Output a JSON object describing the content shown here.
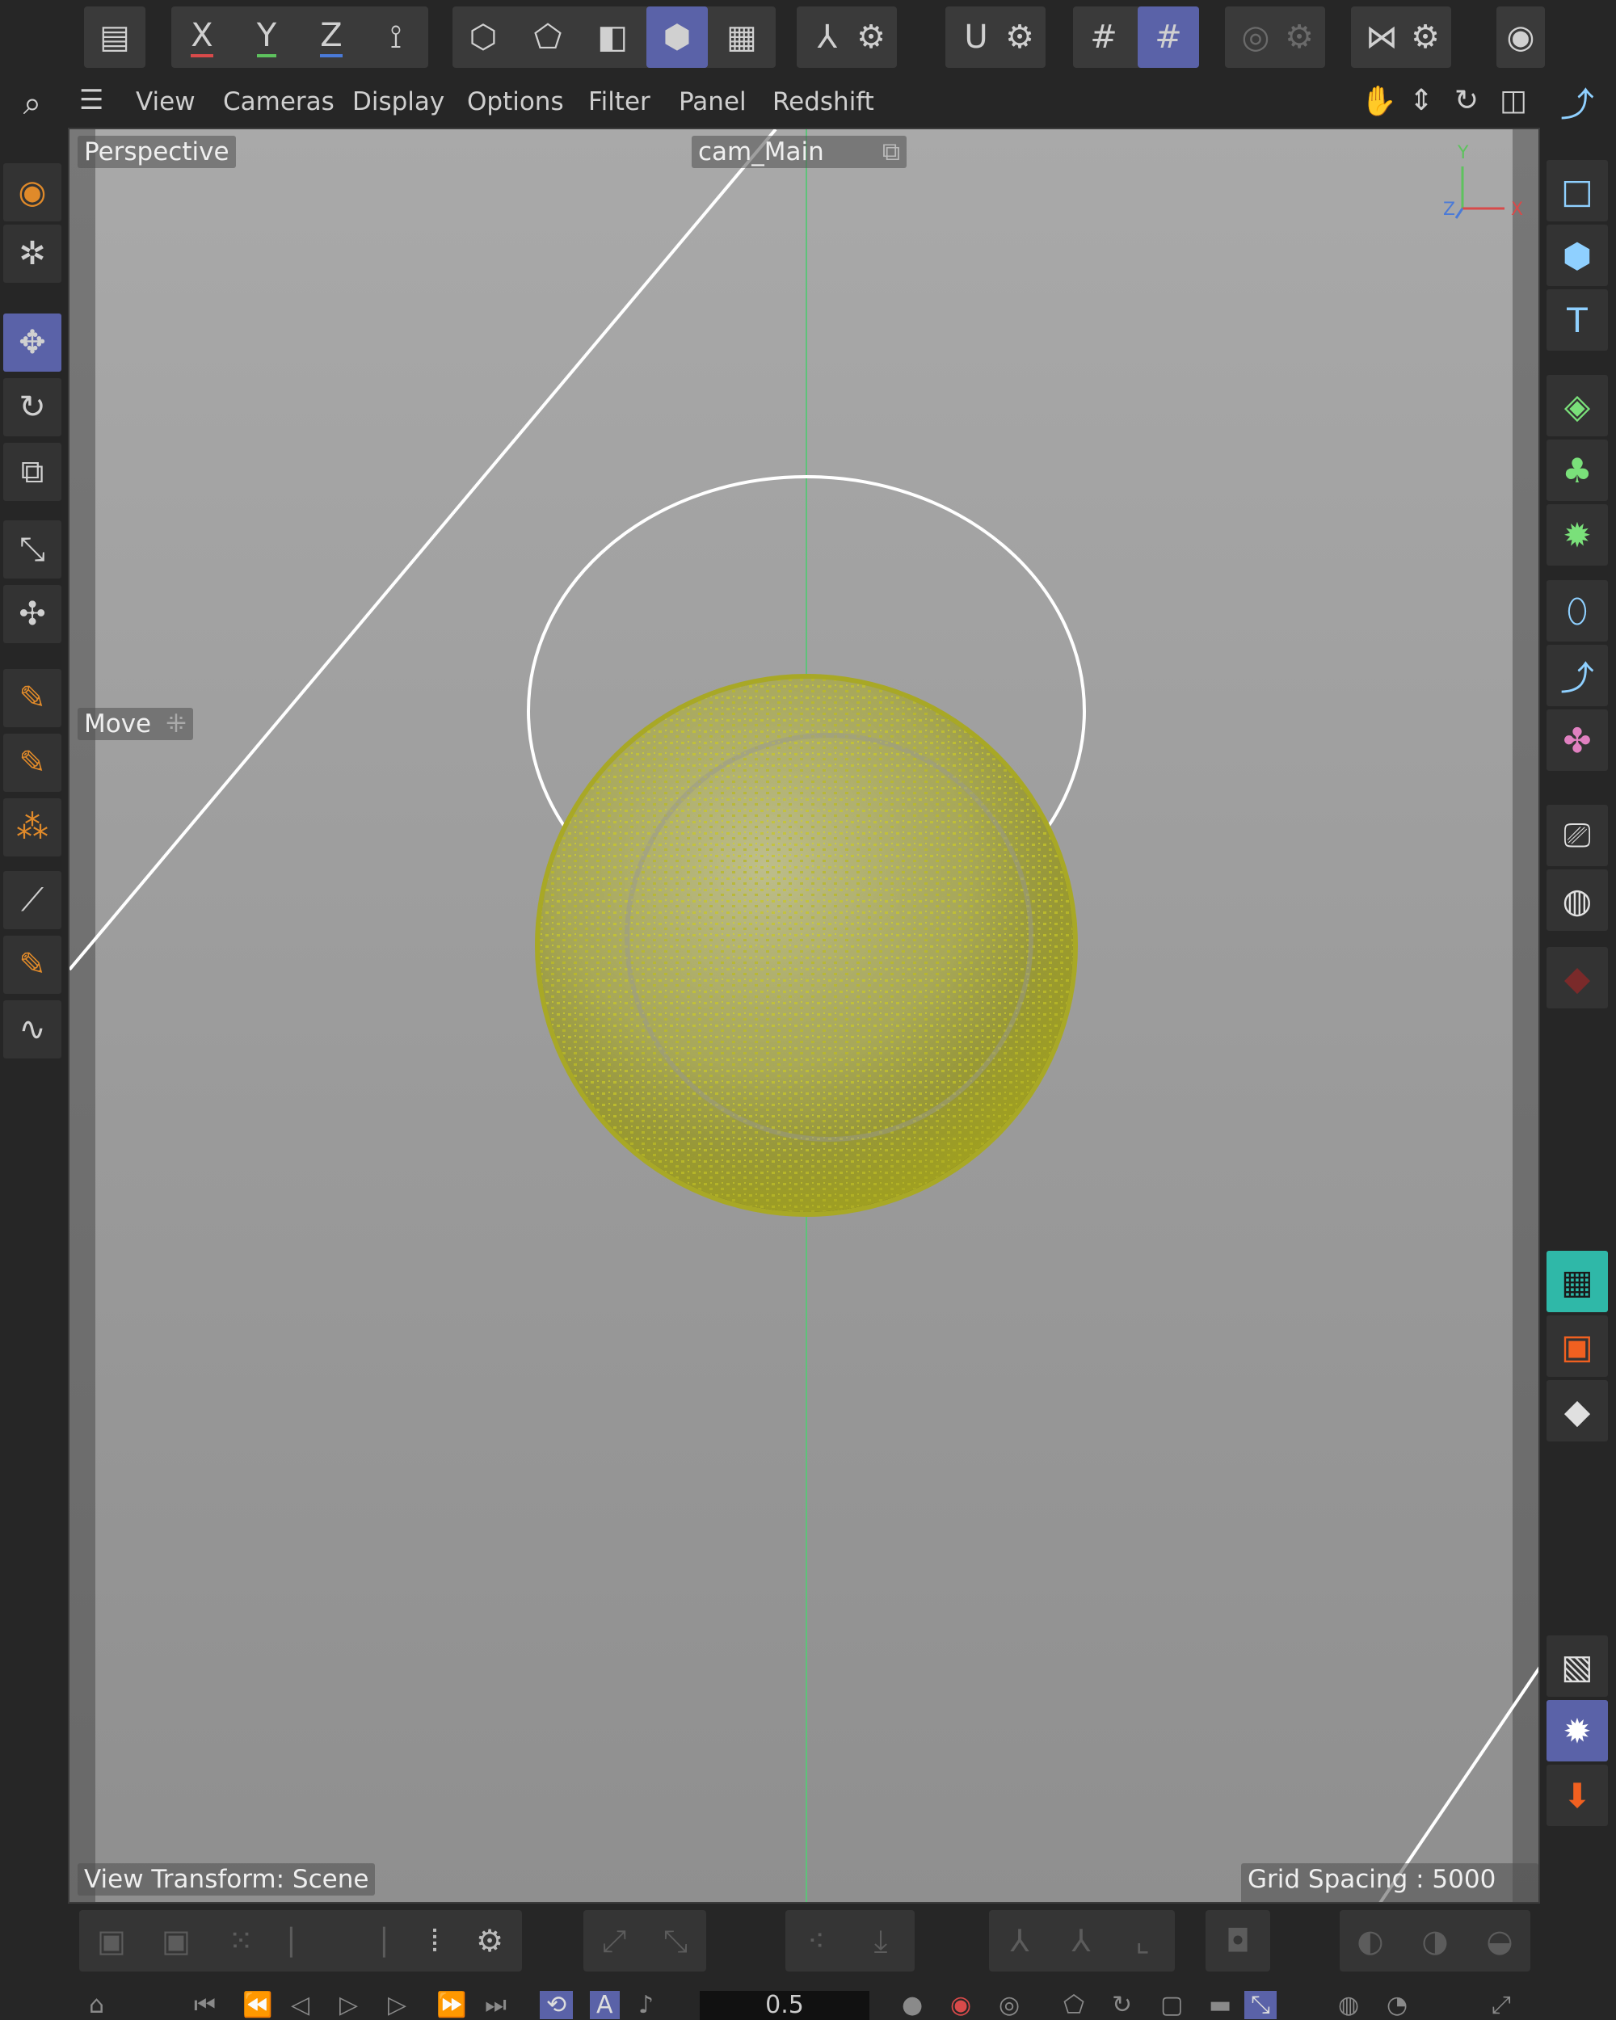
{
  "toolbar": {
    "axis_x": "X",
    "axis_y": "Y",
    "axis_z": "Z",
    "icons": [
      "undo-history-icon",
      "lock-x-icon",
      "lock-y-icon",
      "lock-z-icon",
      "world-coords-icon",
      "points-mode-icon",
      "edges-mode-icon",
      "polygons-mode-icon",
      "model-mode-icon",
      "texture-mode-icon",
      "axis-mode-icon",
      "snap-icon",
      "workplane-icon",
      "grid-snap-icon",
      "soft-selection-icon",
      "symmetry-icon"
    ]
  },
  "menu": {
    "items": [
      "View",
      "Cameras",
      "Display",
      "Options",
      "Filter",
      "Panel",
      "Redshift"
    ]
  },
  "viewport": {
    "projection": "Perspective",
    "camera": "cam_Main",
    "tool_hint": "Move",
    "view_transform": "View Transform: Scene",
    "grid_spacing": "Grid Spacing : 5000 cm",
    "axis_labels": {
      "x": "X",
      "y": "Y",
      "z": "Z"
    }
  },
  "timeline": {
    "frame_value": "0.5"
  },
  "colors": {
    "accent": "#5a62a8",
    "sphere_fuzz": "#b8b82a",
    "axis_green": "#5ec27a",
    "axis_red": "#d84a4a",
    "axis_blue": "#4a7ad8"
  }
}
